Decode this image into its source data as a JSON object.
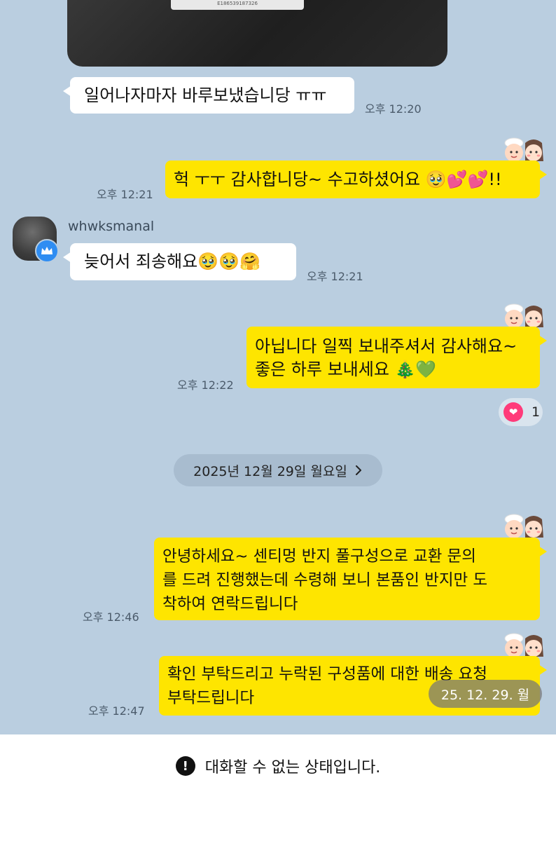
{
  "photo": {
    "label_text": "E186539187326",
    "scan_icon": "text-scan-icon"
  },
  "messages": [
    {
      "side": "in",
      "text": "일어나자마자 바루보냈습니당 ㅠㅠ",
      "time": "오후 12:20"
    },
    {
      "side": "out",
      "text": "헉 ㅜㅜ 감사합니당~ 수고하셨어요 🥹💕💕!!",
      "time": "오후 12:21"
    },
    {
      "side": "in",
      "sender": "whwksmanal",
      "text": "늦어서 죄송해요🥹🥹🤗",
      "time": "오후 12:21"
    },
    {
      "side": "out",
      "lines": [
        "아닙니다 일찍 보내주셔서 감사해요~",
        "좋은 하루 보내세요 🎄💚"
      ],
      "time": "오후 12:22"
    },
    {
      "side": "out",
      "lines": [
        "안녕하세요~ 센티멍 반지 풀구성으로 교환 문의",
        "를 드려 진행했는데 수령해 보니 본품인 반지만 도",
        "착하여 연락드립니다"
      ],
      "time": "오후 12:46"
    },
    {
      "side": "out",
      "lines": [
        "확인 부탁드리고 누락된 구성품에 대한 배송 요청",
        "부탁드립니다"
      ],
      "time": "오후 12:47"
    }
  ],
  "reaction": {
    "icon": "heart-icon",
    "count": "1"
  },
  "date_divider": {
    "label": "2025년 12월 29일 월요일",
    "icon": "chevron-right-icon"
  },
  "date_overlay": "25. 12. 29. 월",
  "sender_badge": "crown-icon",
  "status": {
    "icon": "exclamation-icon",
    "text": "대화할 수 없는 상태입니다."
  },
  "colors": {
    "chat_bg": "#bacee0",
    "bubble_out": "#fee500",
    "bubble_in": "#ffffff",
    "badge_blue": "#2f8df2",
    "reaction_heart": "#ff3b7a"
  }
}
